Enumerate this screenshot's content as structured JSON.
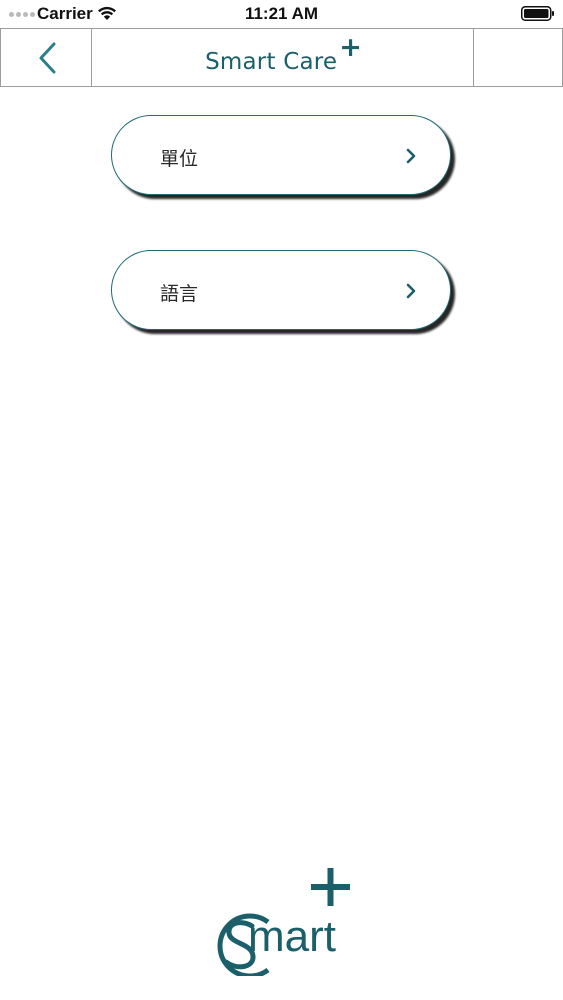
{
  "status_bar": {
    "carrier": "Carrier",
    "time": "11:21 AM"
  },
  "nav": {
    "title": "Smart Care",
    "title_suffix": "+",
    "back_icon": "chevron-left-icon"
  },
  "menu": {
    "items": [
      {
        "label": "單位",
        "icon": "chevron-right-icon"
      },
      {
        "label": "語言",
        "icon": "chevron-right-icon"
      }
    ]
  },
  "logo": {
    "text": "mart",
    "note_letters": "Smart+"
  },
  "colors": {
    "accent": "#1b5f6a",
    "border": "#9c9c9c",
    "pill_border": "#1e6a74"
  }
}
